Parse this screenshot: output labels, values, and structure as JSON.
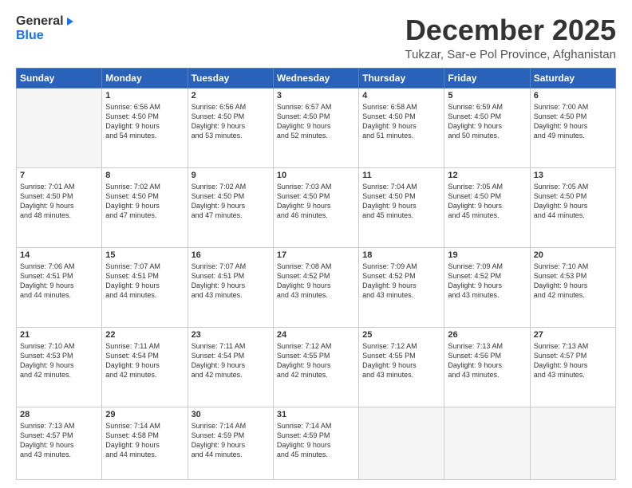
{
  "logo": {
    "general": "General",
    "blue": "Blue"
  },
  "header": {
    "month": "December 2025",
    "location": "Tukzar, Sar-e Pol Province, Afghanistan"
  },
  "weekdays": [
    "Sunday",
    "Monday",
    "Tuesday",
    "Wednesday",
    "Thursday",
    "Friday",
    "Saturday"
  ],
  "weeks": [
    [
      {
        "day": "",
        "info": ""
      },
      {
        "day": "1",
        "info": "Sunrise: 6:56 AM\nSunset: 4:50 PM\nDaylight: 9 hours\nand 54 minutes."
      },
      {
        "day": "2",
        "info": "Sunrise: 6:56 AM\nSunset: 4:50 PM\nDaylight: 9 hours\nand 53 minutes."
      },
      {
        "day": "3",
        "info": "Sunrise: 6:57 AM\nSunset: 4:50 PM\nDaylight: 9 hours\nand 52 minutes."
      },
      {
        "day": "4",
        "info": "Sunrise: 6:58 AM\nSunset: 4:50 PM\nDaylight: 9 hours\nand 51 minutes."
      },
      {
        "day": "5",
        "info": "Sunrise: 6:59 AM\nSunset: 4:50 PM\nDaylight: 9 hours\nand 50 minutes."
      },
      {
        "day": "6",
        "info": "Sunrise: 7:00 AM\nSunset: 4:50 PM\nDaylight: 9 hours\nand 49 minutes."
      }
    ],
    [
      {
        "day": "7",
        "info": "Sunrise: 7:01 AM\nSunset: 4:50 PM\nDaylight: 9 hours\nand 48 minutes."
      },
      {
        "day": "8",
        "info": "Sunrise: 7:02 AM\nSunset: 4:50 PM\nDaylight: 9 hours\nand 47 minutes."
      },
      {
        "day": "9",
        "info": "Sunrise: 7:02 AM\nSunset: 4:50 PM\nDaylight: 9 hours\nand 47 minutes."
      },
      {
        "day": "10",
        "info": "Sunrise: 7:03 AM\nSunset: 4:50 PM\nDaylight: 9 hours\nand 46 minutes."
      },
      {
        "day": "11",
        "info": "Sunrise: 7:04 AM\nSunset: 4:50 PM\nDaylight: 9 hours\nand 45 minutes."
      },
      {
        "day": "12",
        "info": "Sunrise: 7:05 AM\nSunset: 4:50 PM\nDaylight: 9 hours\nand 45 minutes."
      },
      {
        "day": "13",
        "info": "Sunrise: 7:05 AM\nSunset: 4:50 PM\nDaylight: 9 hours\nand 44 minutes."
      }
    ],
    [
      {
        "day": "14",
        "info": "Sunrise: 7:06 AM\nSunset: 4:51 PM\nDaylight: 9 hours\nand 44 minutes."
      },
      {
        "day": "15",
        "info": "Sunrise: 7:07 AM\nSunset: 4:51 PM\nDaylight: 9 hours\nand 44 minutes."
      },
      {
        "day": "16",
        "info": "Sunrise: 7:07 AM\nSunset: 4:51 PM\nDaylight: 9 hours\nand 43 minutes."
      },
      {
        "day": "17",
        "info": "Sunrise: 7:08 AM\nSunset: 4:52 PM\nDaylight: 9 hours\nand 43 minutes."
      },
      {
        "day": "18",
        "info": "Sunrise: 7:09 AM\nSunset: 4:52 PM\nDaylight: 9 hours\nand 43 minutes."
      },
      {
        "day": "19",
        "info": "Sunrise: 7:09 AM\nSunset: 4:52 PM\nDaylight: 9 hours\nand 43 minutes."
      },
      {
        "day": "20",
        "info": "Sunrise: 7:10 AM\nSunset: 4:53 PM\nDaylight: 9 hours\nand 42 minutes."
      }
    ],
    [
      {
        "day": "21",
        "info": "Sunrise: 7:10 AM\nSunset: 4:53 PM\nDaylight: 9 hours\nand 42 minutes."
      },
      {
        "day": "22",
        "info": "Sunrise: 7:11 AM\nSunset: 4:54 PM\nDaylight: 9 hours\nand 42 minutes."
      },
      {
        "day": "23",
        "info": "Sunrise: 7:11 AM\nSunset: 4:54 PM\nDaylight: 9 hours\nand 42 minutes."
      },
      {
        "day": "24",
        "info": "Sunrise: 7:12 AM\nSunset: 4:55 PM\nDaylight: 9 hours\nand 42 minutes."
      },
      {
        "day": "25",
        "info": "Sunrise: 7:12 AM\nSunset: 4:55 PM\nDaylight: 9 hours\nand 43 minutes."
      },
      {
        "day": "26",
        "info": "Sunrise: 7:13 AM\nSunset: 4:56 PM\nDaylight: 9 hours\nand 43 minutes."
      },
      {
        "day": "27",
        "info": "Sunrise: 7:13 AM\nSunset: 4:57 PM\nDaylight: 9 hours\nand 43 minutes."
      }
    ],
    [
      {
        "day": "28",
        "info": "Sunrise: 7:13 AM\nSunset: 4:57 PM\nDaylight: 9 hours\nand 43 minutes."
      },
      {
        "day": "29",
        "info": "Sunrise: 7:14 AM\nSunset: 4:58 PM\nDaylight: 9 hours\nand 44 minutes."
      },
      {
        "day": "30",
        "info": "Sunrise: 7:14 AM\nSunset: 4:59 PM\nDaylight: 9 hours\nand 44 minutes."
      },
      {
        "day": "31",
        "info": "Sunrise: 7:14 AM\nSunset: 4:59 PM\nDaylight: 9 hours\nand 45 minutes."
      },
      {
        "day": "",
        "info": ""
      },
      {
        "day": "",
        "info": ""
      },
      {
        "day": "",
        "info": ""
      }
    ]
  ]
}
